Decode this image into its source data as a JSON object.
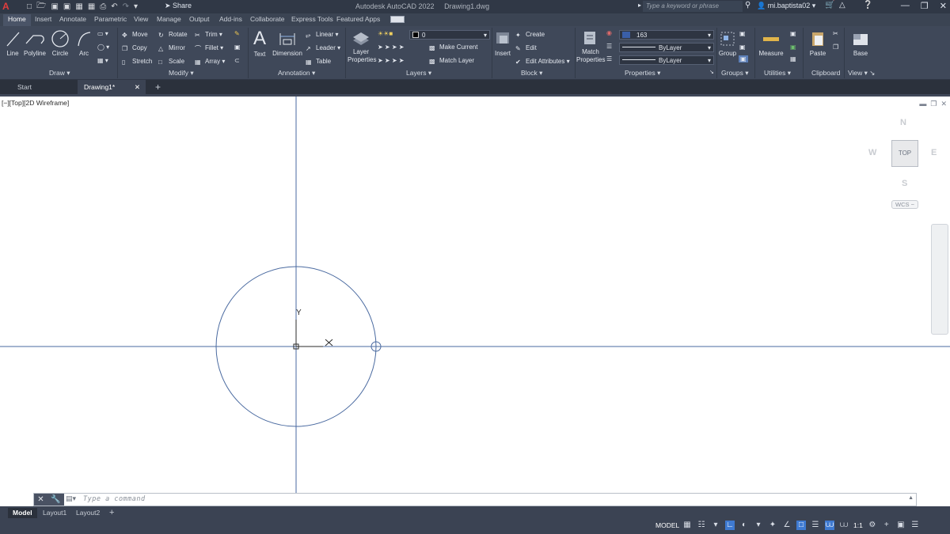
{
  "titlebar": {
    "app_name": "Autodesk AutoCAD 2022",
    "file_name": "Drawing1.dwg",
    "share_label": "Share",
    "search_placeholder": "Type a keyword or phrase",
    "user_name": "mi.baptista02"
  },
  "ribbon_tabs": [
    "Home",
    "Insert",
    "Annotate",
    "Parametric",
    "View",
    "Manage",
    "Output",
    "Add-ins",
    "Collaborate",
    "Express Tools",
    "Featured Apps"
  ],
  "ribbon": {
    "draw": {
      "panel_label": "Draw",
      "line": "Line",
      "polyline": "Polyline",
      "circle": "Circle",
      "arc": "Arc"
    },
    "modify": {
      "panel_label": "Modify",
      "move": "Move",
      "rotate": "Rotate",
      "trim": "Trim",
      "copy": "Copy",
      "mirror": "Mirror",
      "fillet": "Fillet",
      "stretch": "Stretch",
      "scale": "Scale",
      "array": "Array"
    },
    "annotation": {
      "panel_label": "Annotation",
      "text": "Text",
      "dimension": "Dimension",
      "linear": "Linear",
      "leader": "Leader",
      "table": "Table"
    },
    "layers": {
      "panel_label": "Layers",
      "layer_properties_1": "Layer",
      "layer_properties_2": "Properties",
      "current_layer": "0",
      "make_current": "Make Current",
      "match_layer": "Match Layer"
    },
    "block": {
      "panel_label": "Block",
      "insert": "Insert",
      "create": "Create",
      "edit": "Edit",
      "edit_attributes": "Edit Attributes"
    },
    "properties": {
      "panel_label": "Properties",
      "match_1": "Match",
      "match_2": "Properties",
      "color_value": "163",
      "linetype": "ByLayer",
      "lineweight": "ByLayer"
    },
    "groups": {
      "panel_label": "Groups",
      "group": "Group"
    },
    "utilities": {
      "panel_label": "Utilities",
      "measure": "Measure"
    },
    "clipboard": {
      "panel_label": "Clipboard",
      "paste": "Paste"
    },
    "view": {
      "panel_label": "View",
      "base": "Base"
    }
  },
  "file_tabs": {
    "start": "Start",
    "drawing": "Drawing1*"
  },
  "viewport": {
    "label": "[−][Top][2D Wireframe]",
    "axis_y": "Y",
    "nav_cube_face": "TOP",
    "compass_n": "N",
    "compass_s": "S",
    "compass_e": "E",
    "compass_w": "W",
    "wcs": "WCS −"
  },
  "command_line": {
    "placeholder": "Type a command"
  },
  "layout_tabs": [
    "Model",
    "Layout1",
    "Layout2"
  ],
  "status": {
    "model_label": "MODEL",
    "scale": "1:1"
  },
  "colors": {
    "ribbon_bg": "#3f4859",
    "title_bg": "#303846",
    "accent": "#3f7ad1",
    "drawing_line": "#4a6aa0"
  }
}
